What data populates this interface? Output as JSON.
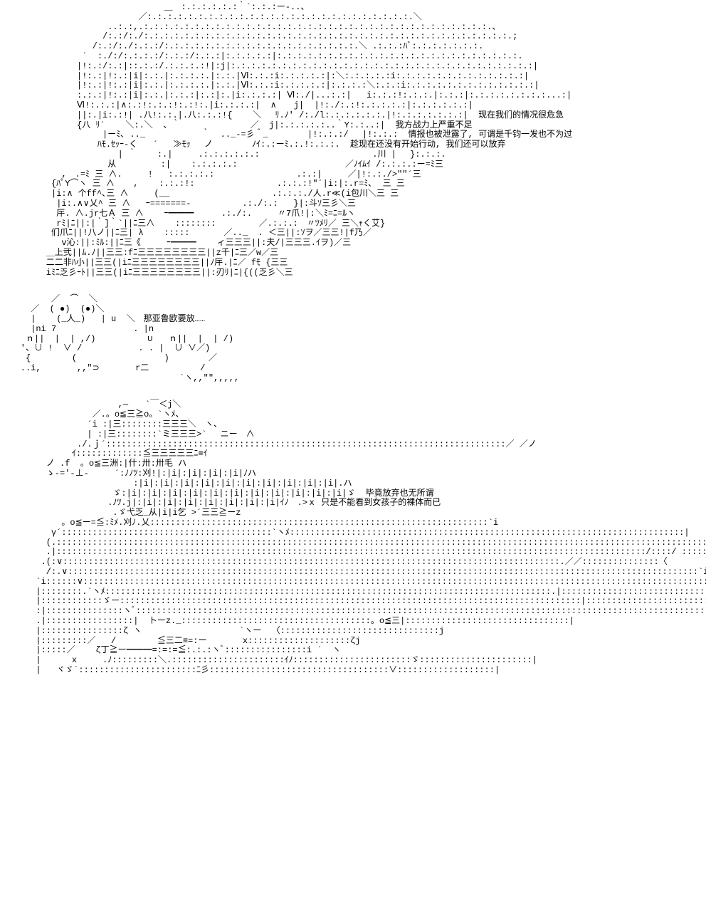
{
  "panels": [
    {
      "id": "panel-1",
      "dialogue": [
        "现在我们的情况很危急",
        "我方战力上严重不足",
        "情报也被泄露了, 可谓是千钧一发也不为过",
        "趁现在还没有开始行动, 我们还可以放弃"
      ],
      "ascii_art": "                                ＿　:.:.:.:.:.:｀`:.:.:ー-..、\n                           ／:.:.:.:.:.:.:.:.:.:.:.:.:.:.:.:.:.:.:.:.:.:.:.:.:.:.＼\n                     ..:.:,.:.:.:.:.:.:.:.:.:.:.:.:.:.:.:.:.:.:.:.:.:.:.:.:.:.:.:.:.:.:.:.:.:.:.、\n                    /:.:/:./:.:.:.:.:.:.:.:.:.:.:.:.:.:.:.:.:.:.:.:.:.:.:.:.:.:.:.:.:.:.:.:.:.:.:.:.;\n                  /:.:/:./:.:.:/:.:.:.:.:.:.:.:.:.:.:.:.:.:.:.:.:.:.:.＼ .:.:.:ﾊﾞ:.:.:.:.:.:.:.\n                ´  :./:/:.:.:.:/:.:.:/:.:.:|:.:.:.:.:|:.:.:.:.:.:.:.:.:.:.:.:.:.:.:.:.:.:.:.:.:.:.:.:.\n               |!:.:/:.:|::.:.:/.:.:.:.:!|:j|:.:.:.:.:.:.:.:.:.:.:.:.:.:.:.:.:.:.:.:.:.:.:.:.:.:.:.:.:.:|\n               |!:.:|!:.:|i|:.:.|:.:.:.:.|:.:.|Ⅵ:.:.:i:.:.:.:.:|:＼:.:.:.:.:i:.:.:.:.:.:.:.:.:.:.:.:.:|\n               |!:.:|!:.:|i|:.:.|:.:.:.:.|:.:.|Ⅵ:.:.:i:.:.:.:.:|:.:.:.:＼:.:.:i:.:.:.:.:.:.:.:.:.:.:.:.:|\n               :.:.:|!:.:|i|:.:.|:.:.:|:.:|:.|i:.:.:.:| Ⅵ:./|...:.:|   i:.:.:!:.:.:.|:.:.:|:.:.:.:.:.:.:.:...:|\n               Ⅵ!:.:.:|∧:.:!:.:.:!:.:!:.|i:.:.:.:|  ∧　　j|  |!:./:.:!:.:.:.:.:|:.:.:.:.:.:|\n               ||:.|i:.:!| .八!:.:.|.八:.:.:!{    ＼　 ﾘ.ﾉ' /:./l:.:.:.:.:.:.|!:.:.:.:.:.:.:|  {TEXT1}\n               {八 ﾘ´    ＼:.＼  、｀  　　　　　　　／  j|:.:.:.:.:..｀Y:.:..:|  {TEXT2}\n                    |ーﾐ､ .._           ｀  .._-=彡＾_     　 |!:.:.:/　 |!:.:.:  {TEXT3}\n                   ﾊﾓ.ｾｯｰ-く   ´   ≫ﾓｯ　 ノ   　   ﾉｲ:.:ーﾐ.:.!:.:.:.  {TEXT4}\n                       | ｀    :.|     .:.:.:.:.:.:                      .川 |　 }:.:.:.\n                     从     　  :|    :.:.:.:.:                     ／ﾉｲﾑｲ /:.:.:.:ー=ﾐ三\n            ,　.=ﾐ 三 ∧.　　　!   :.:.:.:.:                .:.:|     ／|!:.:./>\"\"´三\n          {ﾊﾟY⌒ヽ 三 ∧　  ,    :.:.:!:                .:.:.:!\"´|i:|:.r=ﾐ､  三 三\n          |i:∧ 个ff^､三 ∧     (__                    .:.:.:./人.r≪(i包川＼三 三\n           |i:.∧∨乂^ 三 ∧   ｰ=======-          .:./:.:   }|:斗ｿ三彡＼三\n           厈. ∧.jr七Ａ 三 ∧    ｰ━━━　 　 .:./:.     〃7爪!|:＼ﾐ=ﾆ=ﾙヽ\n           rﾐ|ﾆ||:|｀]｀`||ﾆ三∧    ::::::::　　　　　／.:.:.:　〃ﾂﾒﾘ／ 三＼ｬく艾}\n          们爪ﾆ||!八ノ||ﾆ三| λ    :::::　　　　／.._  . ＜三||:ｿヲ／三三!|f乃／\n            ⅴ沁:||:ﾐﾙ:||ﾆ三《     ｰ━━━    ィ三三三||:夫/|三三三.ｲヲ)／三\n         ＿上弐||ﾑ.ﾉ||三三:fﾆ三三三三三三三三||z千|ﾆ三／w／三\n         二二非ﾊ小||三三(|iﾆ三三三三三三三三||ﾉ厈.|ﾆ／ fﾓ {三三\n         iﾐﾆ乏彡ｰﾄ||三三(|iﾆ三三三三三三三三||:刃ﾘ|ﾆ|{((乏彡＼三"
    },
    {
      "id": "panel-2",
      "dialogue": [
        "那亚鲁欧要放……"
      ],
      "ascii_art": "          ／  ⌒  ＼\n      ／  ( ●)  (●)＼\n      |    (_人_)   | u  ＼　{TEXT1}\n      |ni 7               . |n\n     ｎ||  |  | ,/)          ∪   ｎ||  |  | /)\n    '、∪ !  ∨ /           . . |  ∪ ∨／)\n     {        (                 )    　  ／\n    ..i,       ,,\"⊃       r二          /\n                                   `ヽ,,\"\",,,,,"
    },
    {
      "id": "panel-3",
      "dialogue": [
        "毕竟放弃也无所谓",
        "只是不能看到女孩子的裸体而已"
      ],
      "ascii_art": "                       ,―　　`￣＜j＼\n                  ／.。o≦三≧o。`ヽﾒ、\n                 ´i :|三::::::::三三三＼　ヽ、\n                 | :|三::::::::`ミ三三三>` 　ニー　∧\n               ./.ｊ´::::::::::::::::::::::::::::::::::::::::::::::::::::::::::::::::::::::::::::::／ ／ノ\n              ｲ:::::::::::::≦三三三三三ﾆ≡ｲ\n         ノ .f  。o≦三洲:|什:卅:卅毛 ハ\n         ゝ-='-⊥-     ´:ﾉﾉﾂ:刈!|:|i|:|i|:|i|:|i|ﾉハ\n                          :|i|:|i|:|i|:|i|:|i|:|i|:|i|:|i|:|i|:|i|.ハ\n                      ゞ:|i|:|i|:|i|:|i|:|i|:|i|:|i|:|i|:|i|:|i|:|i|ゞ  {TEXT1}\n                     .ﾉﾂ.j|:|i|:|i|:|i|:|i|:|i|:|i|:|i|ｲﾉ　.>ｘ {TEXT2}\n                      .ゞ弋乏_从|i|i乞 >´三三≧ーz\n            。o≦ー=≦:ﾐﾒ.刈ﾉ.乂::::::::::::::::::::::::::::::::::::::::::::::::::::::::::::::::::`i\n          γ´:::::::::::::::::::::::::::::::::::::::::`ヽﾒ:::::::::::::::::::::::::::::::::::::::::::::::::::::::::::::::::::::::::::::|\n         (.:::::::::::::::::::::::::::::::::::::::::::::::::::::::::::::::::::::::::::::::::::::::::::::::::::::::::::::::::::::::::::::::::::::::::|\n         .|:::::::::::::::::::::::::::::::::::::::::::::::::::::::::::::::::::::::::::::::::::::::::::::::::::::::::::::::::::/::::/ :::::::::/\n        .(:∨:::::::::::::::::::::::::::::::::::::::::::::::::::::::::::::::::::::::::::::::::::::::::::::::::.／／:::::::::::::::〈\n         /:.∨:::::::::::::::::::::::::::::::::::::::::::::::::::::::::::::::::::::::::::::::::::::::::::::::::::::::::::::::::::::::::::`i::::::::::::::::::::ヽ\n       ´i::::::∨:::::::::::::::::::::::::::::::::::::::::::::::::::::::::::::::::::::::::::::::::::::::::::::::::::::::::::::::::::::::::::::::::::::::::::/\n       |::::::::.`ヽﾒ:::::::::::::::::::::::::::::::::::::::::::::::::::::::::::::::::::::::::::::::::::::::.|::::::::::::::::::::::::::::::::`i\n       |::::::::::::ゞー::::::::::::::::::::::::::::::::::::::::::::::::::::::::::::::::::::::::::::::::::::::::::|::::::::::::::::::::::::::::::::.|\n       :|:::::::::::::::ヽﾞ:::::::::::::::::::::::::::::::::::::::::::::::::::::::::::::::::::::::::::::::::::::::::::::::::::::::::::::::::::::::::::::.!\n       .|:::::::::::::::::|  トーz._:::::::::::::::::::::::::::::::::::::。o≦三|::::::::::::::::::::::::::::::::|\n       |::::::::::::::::ζ ヽ                   `ヽー  〈:::::::::::::::::::::::::::::::j\n       |:::::::::／   /        ≦三二≡=:ー       x::::::::::::::::::::ζj\n       |:::::／    ζ丁≧ー━━━=:=:=≦:.:.:ヽﾞ::::::::::::::::i ´  ヽ\n       |      x     .ﾉ:::::::::＼.::::::::::::::::::::::ｲﾉ:::::::::::::::::::::::ゞ::::::::::::::::::::::|\n       |   ヾゞ´:::::::::::::::::::::::ﾆ彡:::::::::::::::::::::::::::::::::::∨:::::::::::::::::::|"
    }
  ]
}
